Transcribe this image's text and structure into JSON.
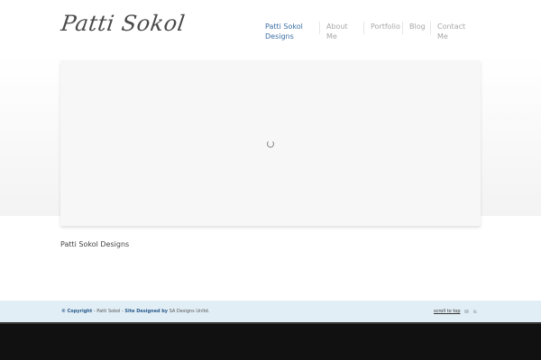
{
  "header": {
    "logo_text": "Patti Sokol"
  },
  "nav": {
    "items": [
      {
        "label": "Patti Sokol Designs",
        "active": true
      },
      {
        "label": "About Me"
      },
      {
        "label": "Portfolio"
      },
      {
        "label": "Blog"
      },
      {
        "label": "Contact Me"
      }
    ]
  },
  "main": {
    "tagline": "Patti Sokol Designs"
  },
  "footer": {
    "copyright_symbol": "©",
    "copyright_label": "Copyright",
    "owner": "Patti Sokol",
    "site_designed_label": "Site Designed",
    "by": "by",
    "designer": "SA Designs Unltd.",
    "scroll_to_top": "scroll to top",
    "icons": [
      "email-icon",
      "rss-icon"
    ]
  },
  "colors": {
    "accent": "#3a6fa4",
    "footer_bg": "#e1eef5",
    "bottom_bar": "#111111"
  }
}
